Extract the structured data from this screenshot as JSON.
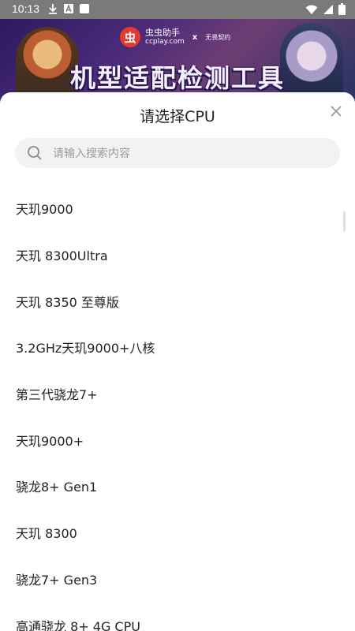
{
  "status_bar": {
    "time": "10:13",
    "icons_left": [
      "download-icon",
      "a-badge-icon",
      "square-icon"
    ],
    "icons_right": [
      "wifi-icon",
      "signal-icon",
      "battery-icon"
    ]
  },
  "banner": {
    "logo_badge": "虫",
    "logo_name": "虫虫助手",
    "logo_domain": "ccplay.com",
    "separator": "x",
    "partner": "无畏契约",
    "title": "机型适配检测工具"
  },
  "sheet": {
    "title": "请选择CPU",
    "search_placeholder": "请输入搜索内容",
    "items": [
      "天玑9000",
      "天玑 8300Ultra",
      "天玑 8350 至尊版",
      "3.2GHz天玑9000+八核",
      "第三代骁龙7+",
      "天玑9000+",
      "骁龙8+ Gen1",
      "天玑 8300",
      "骁龙7+ Gen3",
      "高通骁龙 8+ 4G CPU"
    ]
  },
  "colors": {
    "status_bar": "#7a7a7a",
    "sheet_bg": "#ffffff",
    "search_bg": "#f2f2f2",
    "text": "#222222"
  }
}
